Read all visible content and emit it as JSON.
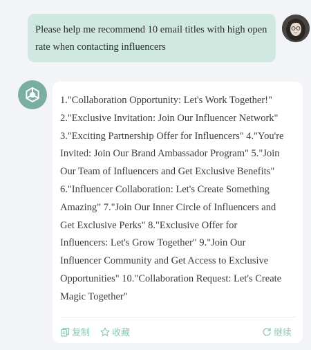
{
  "user_message": "Please help me recommend 10 email titles with high open rate when contacting influencers",
  "assistant_message": "1.\"Collaboration Opportunity: Let's Work Together!\"\n2.\"Exclusive Invitation: Join Our Influencer Network\"\n3.\"Exciting Partnership Offer for Influencers\" 4.\"You're\nInvited: Join Our Brand Ambassador Program\" 5.\"Join\nOur Team of Influencers and Get Exclusive Benefits\"\n6.\"Influencer Collaboration: Let's Create Something\nAmazing\" 7.\"Join Our Inner Circle of Influencers and\nGet Exclusive Perks\" 8.\"Exclusive Offer for\nInfluencers: Let's Grow Together\" 9.\"Join Our\nInfluencer Community and Get Access to Exclusive\nOpportunities\" 10.\"Collaboration Request: Let's Create\nMagic Together\"",
  "actions": {
    "copy_label": "复制",
    "favorite_label": "收藏",
    "continue_label": "继续"
  },
  "icons": {
    "user_avatar": "user-avatar-photo",
    "bot_avatar": "openai-logo-icon",
    "copy": "copy-icon",
    "favorite": "star-icon",
    "continue": "refresh-icon"
  },
  "colors": {
    "user_bubble": "#cfe8e0",
    "bot_avatar": "#7aaea0",
    "accent": "#8bc6b3",
    "background": "#f3f4f8"
  }
}
